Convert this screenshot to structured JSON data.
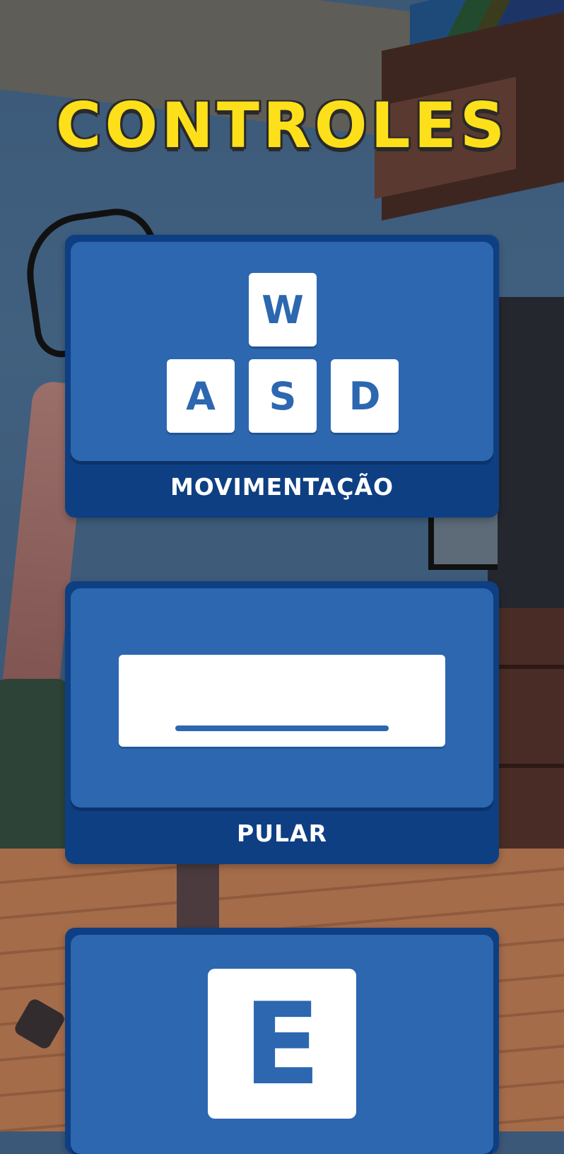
{
  "title": "CONTROLES",
  "colors": {
    "title_yellow": "#fde01a",
    "card_dark_blue": "#0e3f83",
    "card_blue": "#2c67b0",
    "key_white": "#ffffff"
  },
  "controls": [
    {
      "label": "MOVIMENTAÇÃO",
      "keys": [
        "W",
        "A",
        "S",
        "D"
      ]
    },
    {
      "label": "PULAR",
      "key_icon": "spacebar-icon"
    },
    {
      "label": "",
      "keys": [
        "E"
      ]
    }
  ]
}
